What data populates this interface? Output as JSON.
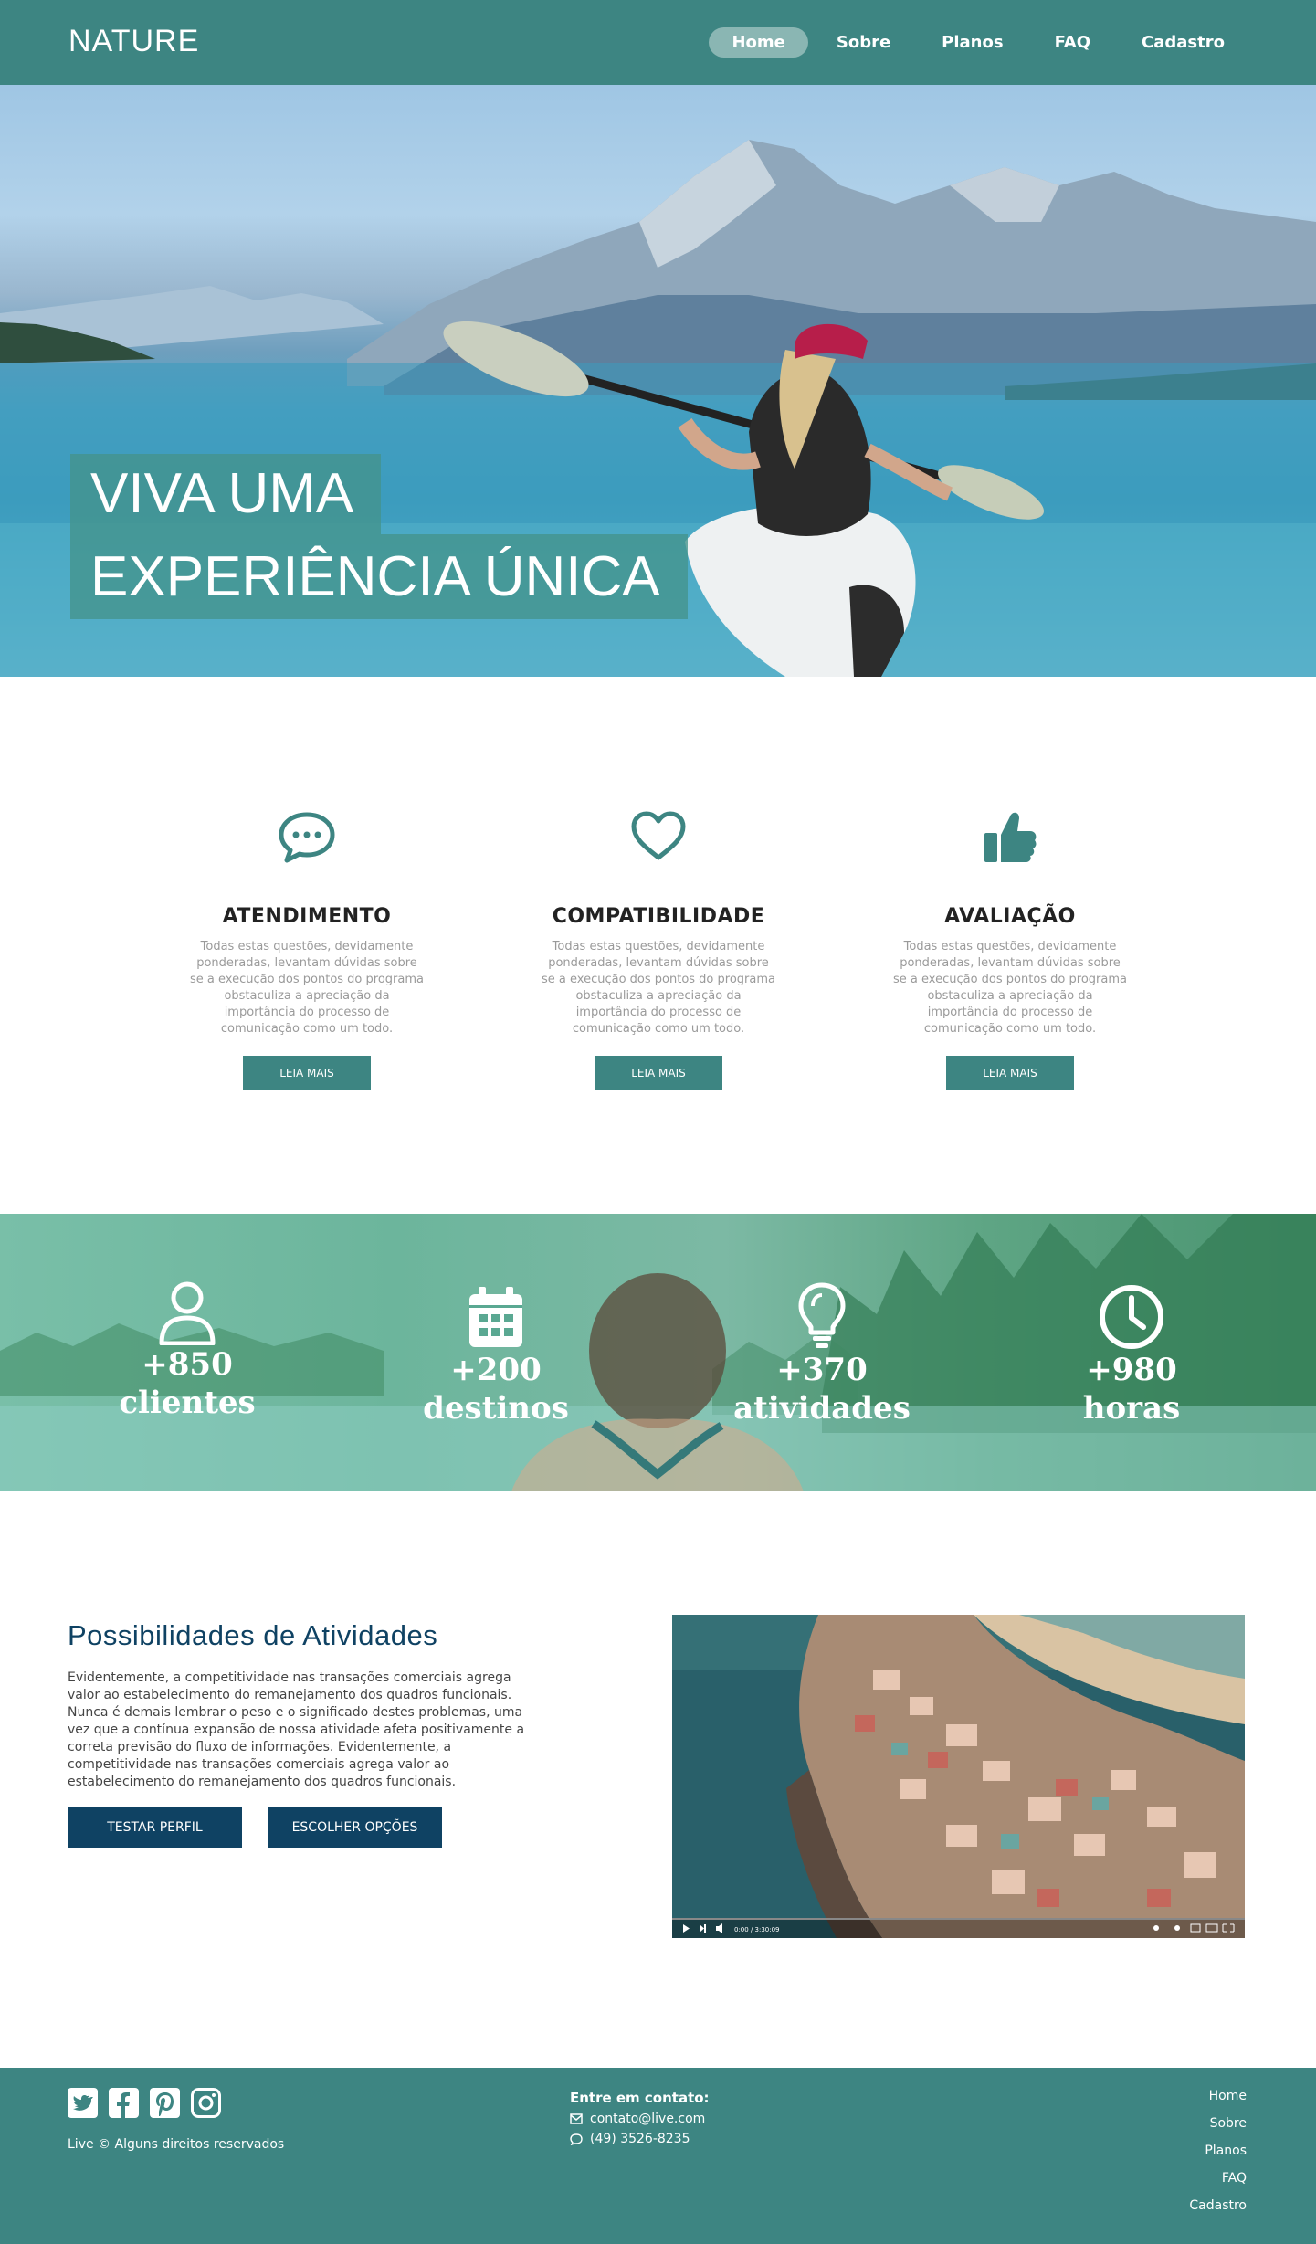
{
  "brand": {
    "logo": "NATURE"
  },
  "nav": {
    "items": [
      {
        "label": "Home",
        "active": true
      },
      {
        "label": "Sobre"
      },
      {
        "label": "Planos"
      },
      {
        "label": "FAQ"
      },
      {
        "label": "Cadastro"
      }
    ]
  },
  "hero": {
    "line1": "VIVA UMA",
    "line2": "EXPERIÊNCIA ÚNICA"
  },
  "features": [
    {
      "icon": "chat-bubble-icon",
      "title": "ATENDIMENTO",
      "text": "Todas estas questões, devidamente ponderadas, levantam dúvidas sobre se a execução dos pontos do programa obstaculiza a apreciação da importância do processo de comunicação como um todo.",
      "button": "LEIA MAIS"
    },
    {
      "icon": "heart-icon",
      "title": "COMPATIBILIDADE",
      "text": "Todas estas questões, devidamente ponderadas, levantam dúvidas sobre se a execução dos pontos do programa obstaculiza a apreciação da importância do processo de comunicação como um todo.",
      "button": "LEIA MAIS"
    },
    {
      "icon": "thumbs-up-icon",
      "title": "AVALIAÇÃO",
      "text": "Todas estas questões, devidamente ponderadas, levantam dúvidas sobre se a execução dos pontos do programa obstaculiza a apreciação da importância do processo de comunicação como um todo.",
      "button": "LEIA MAIS"
    }
  ],
  "stats": [
    {
      "icon": "user-icon",
      "number": "+850",
      "label": "clientes"
    },
    {
      "icon": "calendar-icon",
      "number": "+200",
      "label": "destinos"
    },
    {
      "icon": "lightbulb-icon",
      "number": "+370",
      "label": "atividades"
    },
    {
      "icon": "clock-icon",
      "number": "+980",
      "label": "horas"
    }
  ],
  "activities": {
    "title": "Possibilidades de Atividades",
    "text": "Evidentemente, a competitividade nas transações comerciais agrega valor ao estabelecimento do remanejamento dos quadros funcionais. Nunca é demais lembrar o peso e o significado destes problemas, uma vez que a contínua expansão de nossa atividade afeta positivamente a correta previsão do fluxo de informações. Evidentemente, a competitividade nas transações comerciais agrega valor ao estabelecimento do remanejamento dos quadros funcionais.",
    "btn_primary": "TESTAR PERFIL",
    "btn_secondary": "ESCOLHER OPÇÕES",
    "video_time": "0:00 / 3:30:09"
  },
  "footer": {
    "socials": [
      "twitter-icon",
      "facebook-icon",
      "pinterest-icon",
      "instagram-icon"
    ],
    "rights": "Live © Alguns direitos reservados",
    "contact_title": "Entre em contato:",
    "email": "contato@live.com",
    "phone": "(49) 3526-8235",
    "links": [
      "Home",
      "Sobre",
      "Planos",
      "FAQ",
      "Cadastro"
    ]
  },
  "colors": {
    "primary": "#3d8582",
    "dark_blue": "#0f4263",
    "nav_active": "#8ab6b3"
  }
}
